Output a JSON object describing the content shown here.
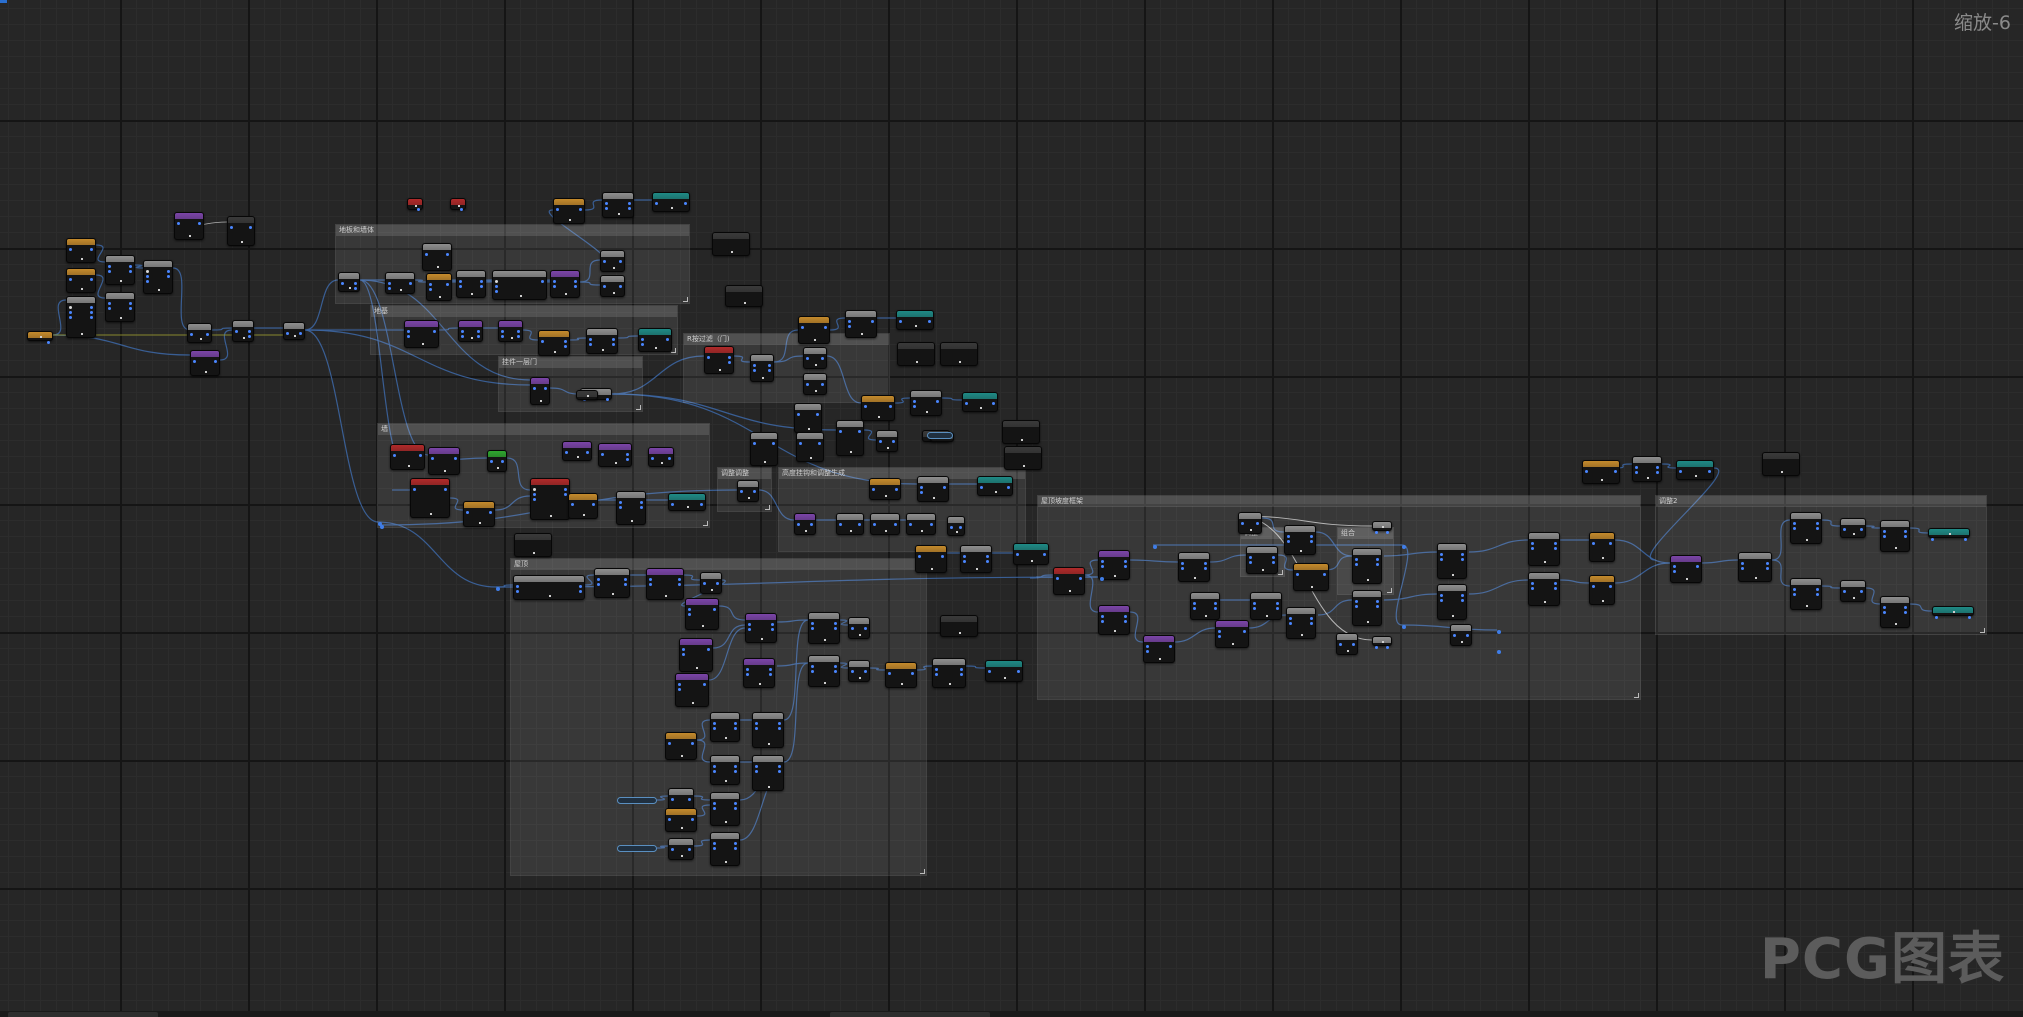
{
  "editor": {
    "zoom_label": "缩放-6",
    "watermark": "PCG图表"
  },
  "colors": {
    "pin": "#4a86ff",
    "wire": "#3d68a8",
    "exec_wire": "#c9c9c9",
    "header_orange": "#c48a2c",
    "header_purple": "#7b45a8",
    "header_teal": "#1f8a85",
    "header_gray": "#8e8e8e",
    "header_red": "#b02a2a",
    "header_green": "#2fa62f"
  },
  "comment_boxes": [
    {
      "title": "地板和墙体"
    },
    {
      "title": "地基"
    },
    {
      "title": "挂件一层门"
    },
    {
      "title": "墙"
    },
    {
      "title": "R按过滤（门)"
    },
    {
      "title": "调整调整"
    },
    {
      "title": "高度挂钩和调整生成"
    },
    {
      "title": "屋顶"
    },
    {
      "title": "屋顶坡度框架"
    },
    {
      "title": "组合"
    },
    {
      "title": "调整2"
    },
    {
      "title": "调整"
    }
  ]
}
